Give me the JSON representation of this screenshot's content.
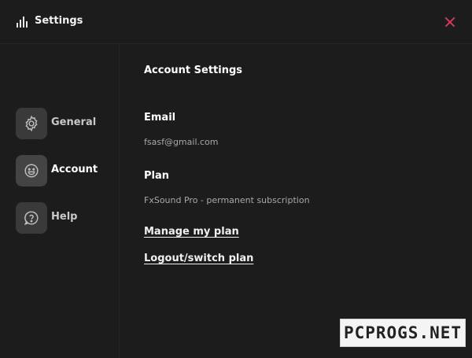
{
  "window": {
    "title": "Settings",
    "app_icon": "equalizer-bars-icon",
    "close_icon": "close-icon",
    "close_color": "#d23a5c"
  },
  "sidebar": {
    "items": [
      {
        "label": "General",
        "icon": "gear-icon",
        "active": false
      },
      {
        "label": "Account",
        "icon": "smiley-icon",
        "active": true
      },
      {
        "label": "Help",
        "icon": "question-bubble-icon",
        "active": false
      }
    ]
  },
  "account": {
    "heading": "Account Settings",
    "email_label": "Email",
    "email_value": "fsasf@gmail.com",
    "plan_label": "Plan",
    "plan_value": "FxSound Pro - permanent subscription",
    "manage_link": "Manage my plan",
    "logout_link": "Logout/switch plan"
  },
  "watermark": {
    "text": "PCPROGS.NET"
  }
}
